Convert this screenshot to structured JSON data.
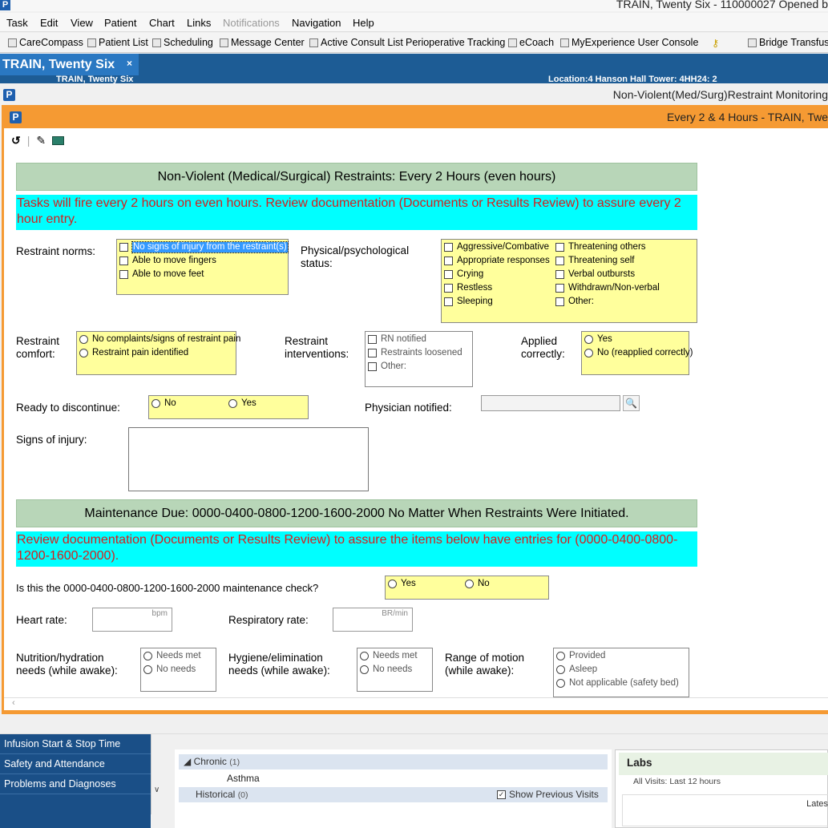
{
  "window": {
    "title": "TRAIN, Twenty Six - 110000027 Opened b",
    "logo": "P"
  },
  "menubar": [
    "Task",
    "Edit",
    "View",
    "Patient",
    "Chart",
    "Links",
    "Notifications",
    "Navigation",
    "Help"
  ],
  "toolbar": [
    "CareCompass",
    "Patient List",
    "Scheduling",
    "Message Center",
    "Active Consult List",
    "Perioperative Tracking",
    "eCoach",
    "MyExperience User Console",
    "Bridge Transfus"
  ],
  "patient_tab": {
    "name": "TRAIN, Twenty Six",
    "close": "×",
    "banner_name": "TRAIN, Twenty Six",
    "banner_location": "Location:4 Hanson Hall Tower: 4HH24: 2"
  },
  "outer_window": {
    "title": "Non-Violent(Med/Surg)Restraint Monitoring"
  },
  "form_window": {
    "title": "Every 2 & 4 Hours - TRAIN, Twe"
  },
  "form": {
    "section1_header": "Non-Violent (Medical/Surgical) Restraints: Every 2 Hours (even hours)",
    "section1_note": "Tasks will fire every 2 hours on even hours. Review documentation (Documents or Results Review) to assure every 2 hour entry.",
    "restraint_norms": {
      "label": "Restraint norms:",
      "options": [
        "No signs of injury from the restraint(s)",
        "Able to move fingers",
        "Able to move feet"
      ]
    },
    "physical_status": {
      "label1": "Physical/psychological",
      "label2": "status:",
      "col1": [
        "Aggressive/Combative",
        "Appropriate responses",
        "Crying",
        "Restless",
        "Sleeping"
      ],
      "col2": [
        "Threatening others",
        "Threatening self",
        "Verbal outbursts",
        "Withdrawn/Non-verbal",
        "Other:"
      ]
    },
    "restraint_comfort": {
      "label1": "Restraint",
      "label2": "comfort:",
      "options": [
        "No complaints/signs of restraint pain",
        "Restraint pain identified"
      ]
    },
    "restraint_interventions": {
      "label1": "Restraint",
      "label2": "interventions:",
      "options": [
        "RN notified",
        "Restraints loosened",
        "Other:"
      ]
    },
    "applied_correctly": {
      "label1": "Applied",
      "label2": "correctly:",
      "options": [
        "Yes",
        "No (reapplied correctly)"
      ]
    },
    "ready_discontinue": {
      "label": "Ready to discontinue:",
      "options": [
        "No",
        "Yes"
      ]
    },
    "physician_notified": {
      "label": "Physician notified:"
    },
    "signs_of_injury": {
      "label": "Signs of injury:"
    },
    "section2_header": "Maintenance Due: 0000-0400-0800-1200-1600-2000 No Matter When Restraints Were Initiated.",
    "section2_note": "Review documentation (Documents or Results Review) to assure the items below have entries for (0000-0400-0800-1200-1600-2000).",
    "maintenance_check": {
      "label": "Is this the 0000-0400-0800-1200-1600-2000 maintenance check?",
      "options": [
        "Yes",
        "No"
      ]
    },
    "heart_rate": {
      "label": "Heart rate:",
      "unit": "bpm"
    },
    "resp_rate": {
      "label": "Respiratory rate:",
      "unit": "BR/min"
    },
    "nutrition": {
      "label1": "Nutrition/hydration",
      "label2": "needs (while awake):",
      "options": [
        "Needs met",
        "No needs"
      ]
    },
    "hygiene": {
      "label1": "Hygiene/elimination",
      "label2": "needs (while awake):",
      "options": [
        "Needs met",
        "No needs"
      ]
    },
    "range_motion": {
      "label1": "Range of motion",
      "label2": "(while awake):",
      "options": [
        "Provided",
        "Asleep",
        "Not applicable (safety bed)"
      ]
    }
  },
  "left_nav": [
    "Infusion Start & Stop Time",
    "Safety and Attendance",
    "Problems and Diagnoses"
  ],
  "problems": {
    "chronic_label": "Chronic",
    "chronic_count": "(1)",
    "chronic_item": "Asthma",
    "historical_label": "Historical",
    "historical_count": "(0)",
    "show_previous": "Show Previous Visits"
  },
  "labs": {
    "title": "Labs",
    "subtitle": "All Visits: Last 12 hours",
    "latest": "Lates"
  },
  "colors": {
    "frame": "#f59a33",
    "header_green": "#b8d6b8",
    "note_cyan": "#00ffff",
    "note_red": "#d4201d",
    "field_yellow": "#ffff9c",
    "nav_blue": "#1a4f87"
  }
}
